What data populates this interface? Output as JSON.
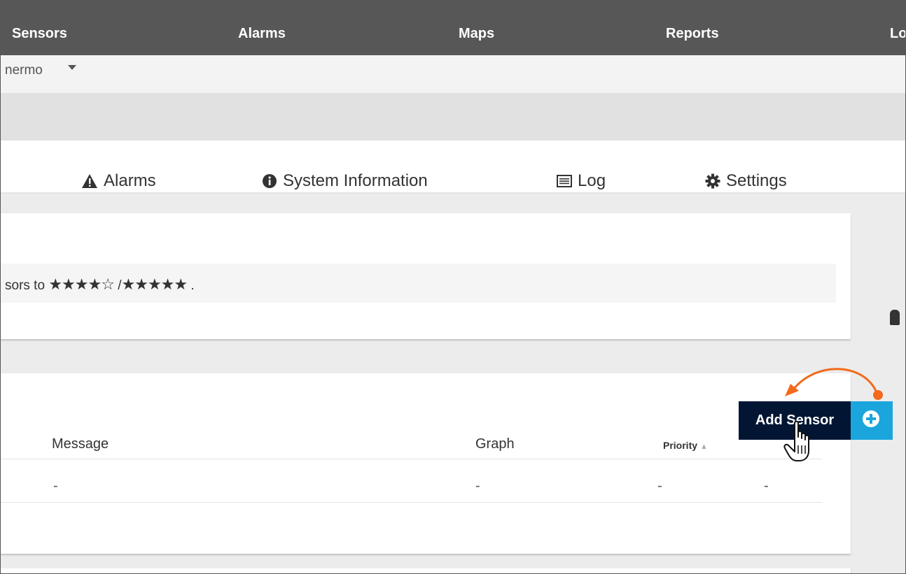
{
  "nav": {
    "items": [
      "Sensors",
      "Alarms",
      "Maps",
      "Reports",
      "Lo"
    ]
  },
  "breadcrumb": {
    "label": "nermo"
  },
  "tabs": [
    {
      "label": "Alarms",
      "icon": "warning-icon"
    },
    {
      "label": "System Information",
      "icon": "info-icon"
    },
    {
      "label": "Log",
      "icon": "log-icon"
    },
    {
      "label": "Settings",
      "icon": "gear-icon"
    }
  ],
  "notice": {
    "text_prefix": "sors to",
    "stars_first": "★★★★☆",
    "separator": "/",
    "stars_second": "★★★★★",
    "suffix": "."
  },
  "table": {
    "headers": [
      "Message",
      "Graph",
      "Priority"
    ],
    "row": [
      "-",
      "-",
      "-",
      "-"
    ]
  },
  "add_button": {
    "label": "Add Sensor"
  },
  "colors": {
    "nav_bg": "#575757",
    "button_dark": "#021634",
    "button_accent": "#1aa6dd",
    "annotation_arrow": "#f26a1b"
  }
}
